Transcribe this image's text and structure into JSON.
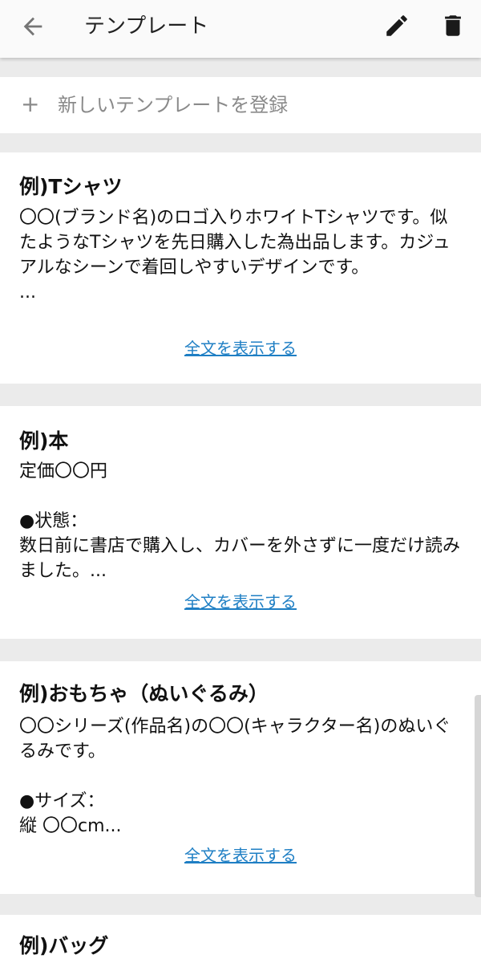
{
  "header": {
    "title": "テンプレート",
    "back_icon": "arrow-left-icon",
    "edit_icon": "pencil-icon",
    "delete_icon": "trash-icon"
  },
  "register": {
    "plus": "+",
    "label": "新しいテンプレートを登録"
  },
  "templates": [
    {
      "title": "例)Tシャツ",
      "body": "〇〇(ブランド名)のロゴ入りホワイトTシャツです。似たようなTシャツを先日購入した為出品します。カジュアルなシーンで着回しやすいデザインです。\n...",
      "more": "全文を表示する"
    },
    {
      "title": "例)本",
      "body": "定価〇〇円\n\n●状態：\n数日前に書店で購入し、カバーを外さずに一度だけ読みました。...",
      "more": "全文を表示する"
    },
    {
      "title": "例)おもちゃ（ぬいぐるみ）",
      "body": "〇〇シリーズ(作品名)の〇〇(キャラクター名)のぬいぐるみです。\n\n●サイズ：\n縦 〇〇cm...",
      "more": "全文を表示する"
    },
    {
      "title": "例)バッグ"
    }
  ],
  "colors": {
    "link": "#1f7fc4",
    "background": "#ebebeb",
    "muted": "#8a8a8a"
  }
}
